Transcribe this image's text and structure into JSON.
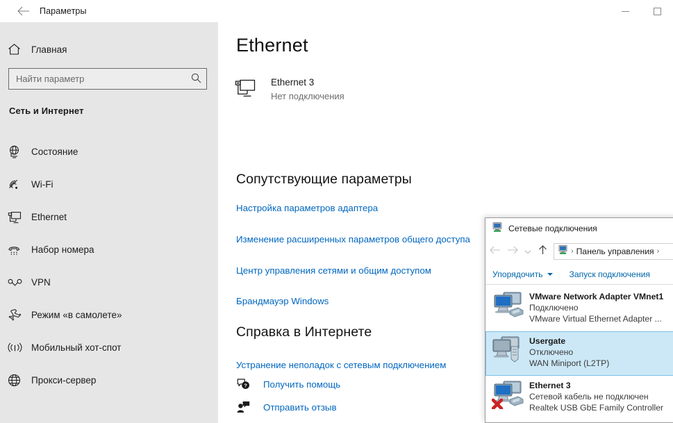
{
  "settings_window": {
    "title": "Параметры",
    "back_icon": "back-arrow-icon",
    "controls": {
      "minimize": "minimize-icon",
      "maximize": "maximize-icon"
    }
  },
  "sidebar": {
    "home": {
      "label": "Главная",
      "icon": "home-icon"
    },
    "search": {
      "placeholder": "Найти параметр",
      "value": "",
      "icon": "search-icon"
    },
    "group_title": "Сеть и Интернет",
    "items": [
      {
        "label": "Состояние",
        "icon": "status-globe-icon"
      },
      {
        "label": "Wi-Fi",
        "icon": "wifi-icon"
      },
      {
        "label": "Ethernet",
        "icon": "ethernet-icon"
      },
      {
        "label": "Набор номера",
        "icon": "dialup-phone-icon"
      },
      {
        "label": "VPN",
        "icon": "vpn-icon"
      },
      {
        "label": "Режим «в самолете»",
        "icon": "airplane-icon"
      },
      {
        "label": "Мобильный хот-спот",
        "icon": "hotspot-icon"
      },
      {
        "label": "Прокси-сервер",
        "icon": "proxy-globe-icon"
      }
    ]
  },
  "main": {
    "title": "Ethernet",
    "adapter": {
      "icon": "ethernet-monitor-icon",
      "name": "Ethernet 3",
      "status": "Нет подключения"
    },
    "related_section": {
      "heading": "Сопутствующие параметры",
      "links": [
        "Настройка параметров адаптера",
        "Изменение расширенных параметров общего доступа",
        "Центр управления сетями и общим доступом",
        "Брандмауэр Windows"
      ]
    },
    "help_section": {
      "heading": "Справка в Интернете",
      "links": [
        "Устранение неполадок с сетевым подключением"
      ],
      "actions": [
        {
          "label": "Получить помощь",
          "icon": "help-question-icon"
        },
        {
          "label": "Отправить отзыв",
          "icon": "feedback-person-icon"
        }
      ]
    }
  },
  "explorer": {
    "title": "Сетевые подключения",
    "title_icon": "network-connections-icon",
    "nav": {
      "back_icon": "back-arrow-icon",
      "forward_icon": "forward-arrow-icon",
      "recent_icon": "chevron-down-icon",
      "up_icon": "up-arrow-icon"
    },
    "breadcrumb": {
      "icon": "network-connections-icon",
      "sep1": "›",
      "item": "Панель управления",
      "sep2": "›"
    },
    "toolbar": [
      {
        "label": "Упорядочить",
        "has_caret": true
      },
      {
        "label": "Запуск подключения",
        "has_caret": false
      }
    ],
    "connections": [
      {
        "name": "VMware Network Adapter VMnet1",
        "status": "Подключено",
        "device": "VMware Virtual Ethernet Adapter ...",
        "selected": false,
        "icon": "network-adapter-icon",
        "error": false
      },
      {
        "name": "Usergate",
        "status": "Отключено",
        "device": "WAN Miniport (L2TP)",
        "selected": true,
        "icon": "vpn-connection-icon",
        "error": false
      },
      {
        "name": "Ethernet 3",
        "status": "Сетевой кабель не подключен",
        "device": "Realtek USB GbE Family Controller",
        "selected": false,
        "icon": "network-adapter-icon",
        "error": true
      }
    ]
  },
  "colors": {
    "accent_link": "#0067c0",
    "sidebar_bg": "#e6e6e6",
    "selection_bg": "#cce8f7",
    "selection_border": "#7bc0e6",
    "error_red": "#d83b01"
  }
}
